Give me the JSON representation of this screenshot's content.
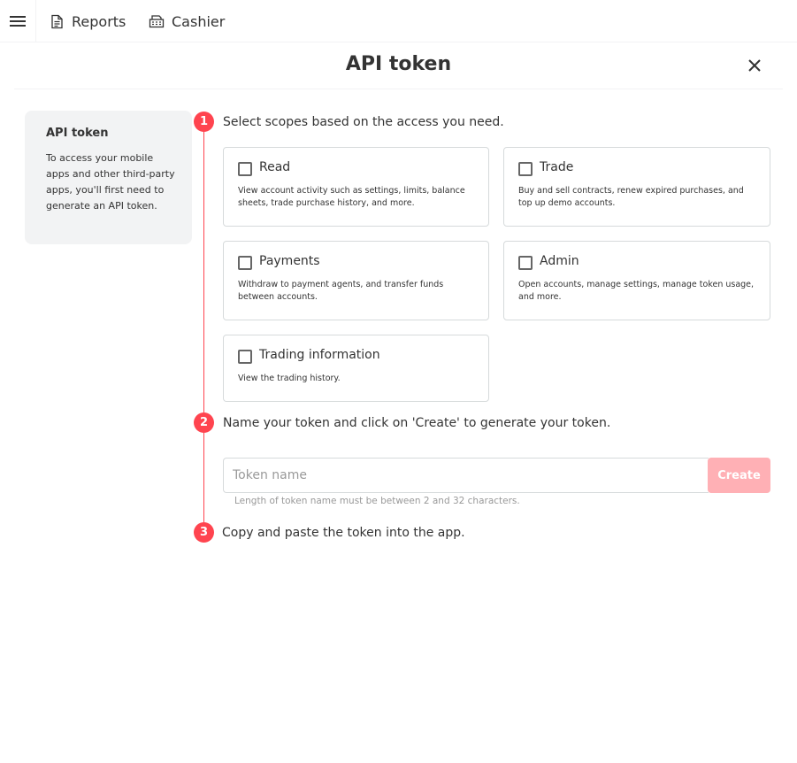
{
  "nav": {
    "reports_label": "Reports",
    "cashier_label": "Cashier"
  },
  "modal": {
    "title": "API token"
  },
  "side": {
    "title": "API token",
    "text": "To access your mobile apps and other third-party apps, you'll first need to generate an API token."
  },
  "steps": [
    {
      "number": "1",
      "text": "Select scopes based on the access you need."
    },
    {
      "number": "2",
      "text": "Name your token and click on 'Create' to generate your token."
    },
    {
      "number": "3",
      "text": "Copy and paste the token into the app."
    }
  ],
  "scopes": [
    {
      "label": "Read",
      "description": "View account activity such as settings, limits, balance sheets, trade purchase history, and more.",
      "checked": false
    },
    {
      "label": "Trade",
      "description": "Buy and sell contracts, renew expired purchases, and top up demo accounts.",
      "checked": false
    },
    {
      "label": "Payments",
      "description": "Withdraw to payment agents, and transfer funds between accounts.",
      "checked": false
    },
    {
      "label": "Admin",
      "description": "Open accounts, manage settings, manage token usage, and more.",
      "checked": false
    },
    {
      "label": "Trading information",
      "description": "View the trading history.",
      "checked": false
    }
  ],
  "token": {
    "placeholder": "Token name",
    "value": "",
    "create_label": "Create",
    "hint": "Length of token name must be between 2 and 32 characters."
  },
  "colors": {
    "accent": "#ff444f",
    "create_disabled": "#ffb0b5",
    "side_bg": "#f2f3f4",
    "border": "#d6dadb"
  },
  "icons": {
    "menu": "hamburger-menu-icon",
    "reports": "document-report-icon",
    "cashier": "cashier-register-icon",
    "close": "close-icon"
  }
}
